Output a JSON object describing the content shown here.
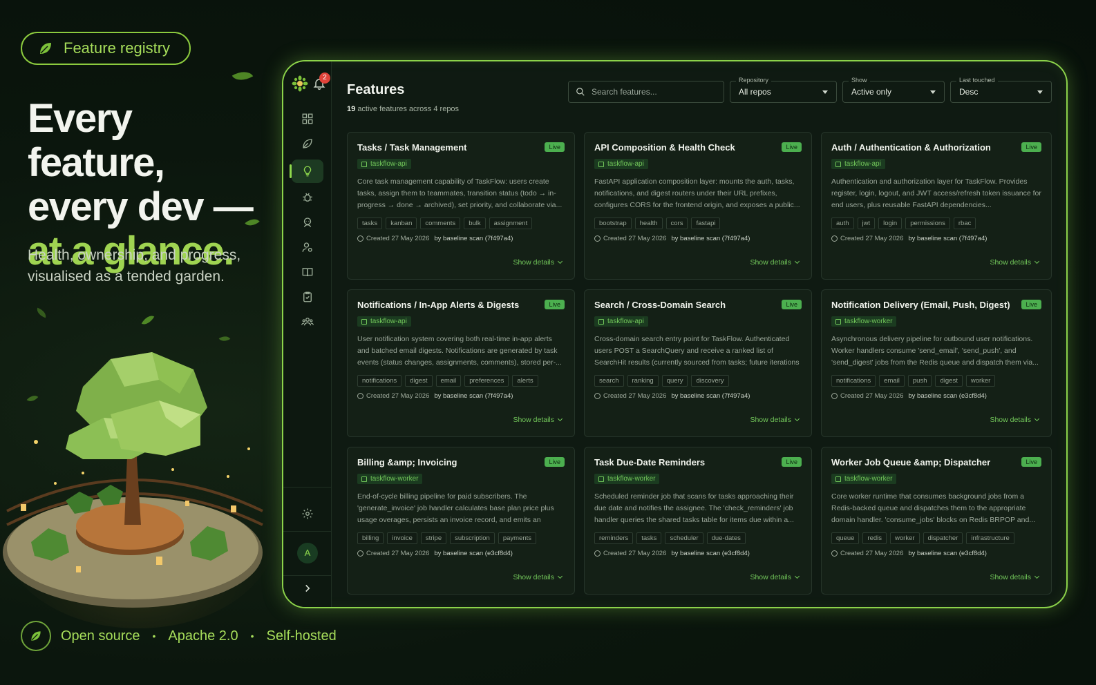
{
  "promo": {
    "pill_label": "Feature registry",
    "headline_line1": "Every feature,",
    "headline_line2": "every dev —",
    "headline_accent": "at a glance.",
    "subtitle": "Health, ownership, and progress, visualised as a tended garden.",
    "footer": [
      "Open source",
      "Apache 2.0",
      "Self-hosted"
    ]
  },
  "sidebar": {
    "notification_count": "2",
    "avatar_initial": "A",
    "nav_icons": [
      "dashboard-icon",
      "leaf-icon",
      "lightbulb-icon",
      "bug-icon",
      "bot-icon",
      "user-settings-icon",
      "book-icon",
      "clipboard-check-icon",
      "team-icon"
    ],
    "active_item": "lightbulb-icon",
    "bottom_icons": [
      "gear-icon",
      "chevron-right-icon"
    ]
  },
  "header": {
    "title": "Features",
    "count": "19",
    "summary": "active features across 4 repos"
  },
  "filters": {
    "search_placeholder": "Search features...",
    "repository": {
      "label": "Repository",
      "value": "All repos"
    },
    "show": {
      "label": "Show",
      "value": "Active only"
    },
    "last_touched": {
      "label": "Last touched",
      "value": "Desc"
    }
  },
  "status_label": "Live",
  "details_label": "Show details",
  "colors": {
    "accent": "#8cd34a",
    "live_badge": "#4caf4f",
    "repo_text": "#72c75a",
    "background": "#0f1a12"
  },
  "cards": [
    {
      "title": "Tasks / Task Management",
      "repo": "taskflow-api",
      "description": "Core task management capability of TaskFlow: users create tasks, assign them to teammates, transition status (todo → in-progress → done → archived), set priority, and collaborate via...",
      "tags": [
        "tasks",
        "kanban",
        "comments",
        "bulk",
        "assignment"
      ],
      "created": "Created 27 May 2026",
      "by": "by baseline scan (7f497a4)"
    },
    {
      "title": "API Composition & Health Check",
      "repo": "taskflow-api",
      "description": "FastAPI application composition layer: mounts the auth, tasks, notifications, and digest routers under their URL prefixes, configures CORS for the frontend origin, and exposes a public...",
      "tags": [
        "bootstrap",
        "health",
        "cors",
        "fastapi"
      ],
      "created": "Created 27 May 2026",
      "by": "by baseline scan (7f497a4)"
    },
    {
      "title": "Auth / Authentication & Authorization",
      "repo": "taskflow-api",
      "description": "Authentication and authorization layer for TaskFlow. Provides register, login, logout, and JWT access/refresh token issuance for end users, plus reusable FastAPI dependencies...",
      "tags": [
        "auth",
        "jwt",
        "login",
        "permissions",
        "rbac"
      ],
      "created": "Created 27 May 2026",
      "by": "by baseline scan (7f497a4)"
    },
    {
      "title": "Notifications / In-App Alerts & Digests",
      "repo": "taskflow-api",
      "description": "User notification system covering both real-time in-app alerts and batched email digests. Notifications are generated by task events (status changes, assignments, comments), stored per-...",
      "tags": [
        "notifications",
        "digest",
        "email",
        "preferences",
        "alerts"
      ],
      "created": "Created 27 May 2026",
      "by": "by baseline scan (7f497a4)"
    },
    {
      "title": "Search / Cross-Domain Search",
      "repo": "taskflow-api",
      "description": "Cross-domain search entry point for TaskFlow. Authenticated users POST a SearchQuery and receive a ranked list of SearchHit results (currently sourced from tasks; future iterations will...",
      "tags": [
        "search",
        "ranking",
        "query",
        "discovery"
      ],
      "created": "Created 27 May 2026",
      "by": "by baseline scan (7f497a4)"
    },
    {
      "title": "Notification Delivery (Email, Push, Digest)",
      "repo": "taskflow-worker",
      "description": "Asynchronous delivery pipeline for outbound user notifications. Worker handlers consume 'send_email', 'send_push', and 'send_digest' jobs from the Redis queue and dispatch them via...",
      "tags": [
        "notifications",
        "email",
        "push",
        "digest",
        "worker"
      ],
      "created": "Created 27 May 2026",
      "by": "by baseline scan (e3cf8d4)"
    },
    {
      "title": "Billing &amp; Invoicing",
      "repo": "taskflow-worker",
      "description": "End-of-cycle billing pipeline for paid subscribers. The 'generate_invoice' job handler calculates base plan price plus usage overages, persists an invoice record, and emits an 'invoic...",
      "tags": [
        "billing",
        "invoice",
        "stripe",
        "subscription",
        "payments"
      ],
      "created": "Created 27 May 2026",
      "by": "by baseline scan (e3cf8d4)"
    },
    {
      "title": "Task Due-Date Reminders",
      "repo": "taskflow-worker",
      "description": "Scheduled reminder job that scans for tasks approaching their due date and notifies the assignee. The 'check_reminders' job handler queries the shared tasks table for items due within a...",
      "tags": [
        "reminders",
        "tasks",
        "scheduler",
        "due-dates"
      ],
      "created": "Created 27 May 2026",
      "by": "by baseline scan (e3cf8d4)"
    },
    {
      "title": "Worker Job Queue &amp; Dispatcher",
      "repo": "taskflow-worker",
      "description": "Core worker runtime that consumes background jobs from a Redis-backed queue and dispatches them to the appropriate domain handler. 'consume_jobs' blocks on Redis BRPOP and...",
      "tags": [
        "queue",
        "redis",
        "worker",
        "dispatcher",
        "infrastructure"
      ],
      "created": "Created 27 May 2026",
      "by": "by baseline scan (e3cf8d4)"
    }
  ]
}
